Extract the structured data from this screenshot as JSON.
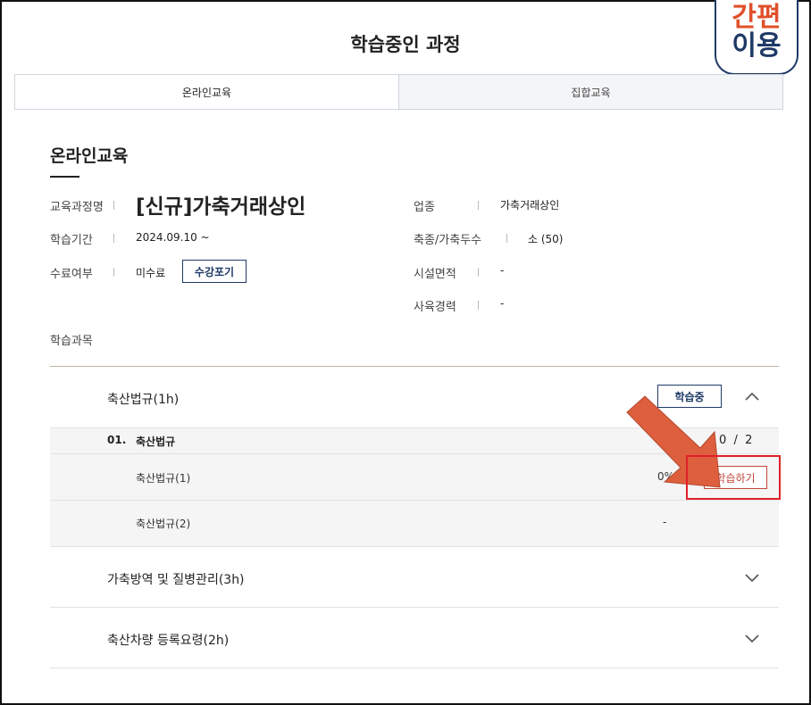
{
  "page": {
    "title": "학습중인 과정",
    "badge_line1": "간편",
    "badge_line2": "이용"
  },
  "tabs": [
    {
      "label": "온라인교육",
      "active": true
    },
    {
      "label": "집합교육",
      "active": false
    }
  ],
  "section": {
    "title": "온라인교육"
  },
  "info_left": {
    "course_label": "교육과정명",
    "course_value": "[신규]가축거래상인",
    "period_label": "학습기간",
    "period_value": "2024.09.10 ~",
    "completion_label": "수료여부",
    "completion_value": "미수료",
    "cancel_button": "수강포기"
  },
  "info_right": {
    "industry_label": "업종",
    "industry_value": "가축거래상인",
    "livestock_label": "축종/가축두수",
    "livestock_value": "소 (50)",
    "facility_label": "시설면적",
    "facility_value": "-",
    "career_label": "사육경력",
    "career_value": "-"
  },
  "subjects_label": "학습과목",
  "accordion": [
    {
      "title": "축산법규(1h)",
      "status_button": "학습중",
      "expanded": true,
      "group_number": "01.",
      "group_title": "축산법규",
      "group_progress": "0  /  2",
      "items": [
        {
          "title": "축산법규(1)",
          "progress": "0%",
          "action": "학습하기"
        },
        {
          "title": "축산법규(2)",
          "progress": "-",
          "action": ""
        }
      ]
    },
    {
      "title": "가축방역 및 질병관리(3h)",
      "expanded": false
    },
    {
      "title": "축산차량 등록요령(2h)",
      "expanded": false
    }
  ],
  "colors": {
    "navy": "#1f3a66",
    "accent_red": "#e0202a",
    "arrow_orange": "#dd5f3e"
  }
}
